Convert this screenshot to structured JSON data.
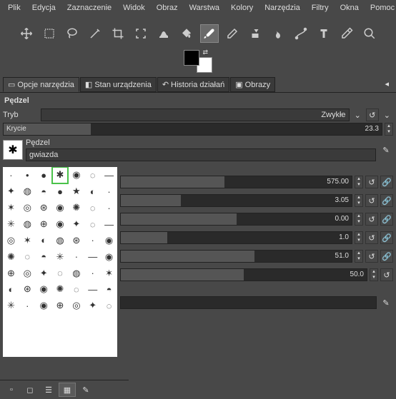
{
  "menu": [
    "Plik",
    "Edycja",
    "Zaznaczenie",
    "Widok",
    "Obraz",
    "Warstwa",
    "Kolory",
    "Narzędzia",
    "Filtry",
    "Okna",
    "Pomoc"
  ],
  "tabs": {
    "t0": "Opcje narzędzia",
    "t1": "Stan urządzenia",
    "t2": "Historia działań",
    "t3": "Obrazy"
  },
  "panel_title": "Pędzel",
  "mode": {
    "label": "Tryb",
    "value": "Zwykłe"
  },
  "opacity": {
    "label": "Krycie",
    "value": "23.3"
  },
  "brush": {
    "caption": "Pędzel",
    "name": "gwiazda"
  },
  "params": {
    "p0": {
      "value": "575.00",
      "fill": 45
    },
    "p1": {
      "value": "3.05",
      "fill": 26
    },
    "p2": {
      "value": "0.00",
      "fill": 50
    },
    "p3": {
      "value": "1.0",
      "fill": 20
    },
    "p4": {
      "value": "51.0",
      "fill": 58
    },
    "p5": {
      "value": "50.0",
      "fill": 50
    }
  },
  "colors": {
    "fg": "#000000",
    "bg": "#ffffff",
    "accent": "#4ac24a"
  }
}
